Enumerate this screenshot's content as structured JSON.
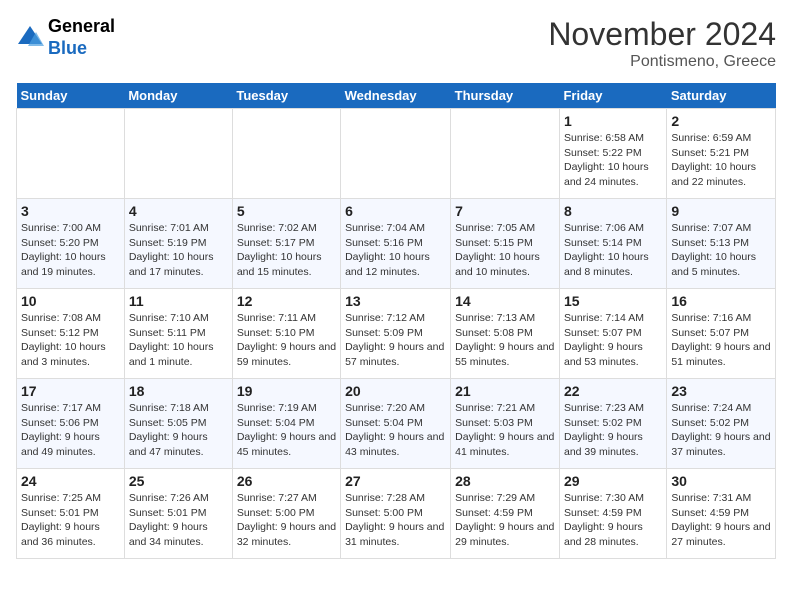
{
  "logo": {
    "line1": "General",
    "line2": "Blue"
  },
  "title": "November 2024",
  "location": "Pontismeno, Greece",
  "days_of_week": [
    "Sunday",
    "Monday",
    "Tuesday",
    "Wednesday",
    "Thursday",
    "Friday",
    "Saturday"
  ],
  "weeks": [
    [
      {
        "day": "",
        "info": ""
      },
      {
        "day": "",
        "info": ""
      },
      {
        "day": "",
        "info": ""
      },
      {
        "day": "",
        "info": ""
      },
      {
        "day": "",
        "info": ""
      },
      {
        "day": "1",
        "info": "Sunrise: 6:58 AM\nSunset: 5:22 PM\nDaylight: 10 hours and 24 minutes."
      },
      {
        "day": "2",
        "info": "Sunrise: 6:59 AM\nSunset: 5:21 PM\nDaylight: 10 hours and 22 minutes."
      }
    ],
    [
      {
        "day": "3",
        "info": "Sunrise: 7:00 AM\nSunset: 5:20 PM\nDaylight: 10 hours and 19 minutes."
      },
      {
        "day": "4",
        "info": "Sunrise: 7:01 AM\nSunset: 5:19 PM\nDaylight: 10 hours and 17 minutes."
      },
      {
        "day": "5",
        "info": "Sunrise: 7:02 AM\nSunset: 5:17 PM\nDaylight: 10 hours and 15 minutes."
      },
      {
        "day": "6",
        "info": "Sunrise: 7:04 AM\nSunset: 5:16 PM\nDaylight: 10 hours and 12 minutes."
      },
      {
        "day": "7",
        "info": "Sunrise: 7:05 AM\nSunset: 5:15 PM\nDaylight: 10 hours and 10 minutes."
      },
      {
        "day": "8",
        "info": "Sunrise: 7:06 AM\nSunset: 5:14 PM\nDaylight: 10 hours and 8 minutes."
      },
      {
        "day": "9",
        "info": "Sunrise: 7:07 AM\nSunset: 5:13 PM\nDaylight: 10 hours and 5 minutes."
      }
    ],
    [
      {
        "day": "10",
        "info": "Sunrise: 7:08 AM\nSunset: 5:12 PM\nDaylight: 10 hours and 3 minutes."
      },
      {
        "day": "11",
        "info": "Sunrise: 7:10 AM\nSunset: 5:11 PM\nDaylight: 10 hours and 1 minute."
      },
      {
        "day": "12",
        "info": "Sunrise: 7:11 AM\nSunset: 5:10 PM\nDaylight: 9 hours and 59 minutes."
      },
      {
        "day": "13",
        "info": "Sunrise: 7:12 AM\nSunset: 5:09 PM\nDaylight: 9 hours and 57 minutes."
      },
      {
        "day": "14",
        "info": "Sunrise: 7:13 AM\nSunset: 5:08 PM\nDaylight: 9 hours and 55 minutes."
      },
      {
        "day": "15",
        "info": "Sunrise: 7:14 AM\nSunset: 5:07 PM\nDaylight: 9 hours and 53 minutes."
      },
      {
        "day": "16",
        "info": "Sunrise: 7:16 AM\nSunset: 5:07 PM\nDaylight: 9 hours and 51 minutes."
      }
    ],
    [
      {
        "day": "17",
        "info": "Sunrise: 7:17 AM\nSunset: 5:06 PM\nDaylight: 9 hours and 49 minutes."
      },
      {
        "day": "18",
        "info": "Sunrise: 7:18 AM\nSunset: 5:05 PM\nDaylight: 9 hours and 47 minutes."
      },
      {
        "day": "19",
        "info": "Sunrise: 7:19 AM\nSunset: 5:04 PM\nDaylight: 9 hours and 45 minutes."
      },
      {
        "day": "20",
        "info": "Sunrise: 7:20 AM\nSunset: 5:04 PM\nDaylight: 9 hours and 43 minutes."
      },
      {
        "day": "21",
        "info": "Sunrise: 7:21 AM\nSunset: 5:03 PM\nDaylight: 9 hours and 41 minutes."
      },
      {
        "day": "22",
        "info": "Sunrise: 7:23 AM\nSunset: 5:02 PM\nDaylight: 9 hours and 39 minutes."
      },
      {
        "day": "23",
        "info": "Sunrise: 7:24 AM\nSunset: 5:02 PM\nDaylight: 9 hours and 37 minutes."
      }
    ],
    [
      {
        "day": "24",
        "info": "Sunrise: 7:25 AM\nSunset: 5:01 PM\nDaylight: 9 hours and 36 minutes."
      },
      {
        "day": "25",
        "info": "Sunrise: 7:26 AM\nSunset: 5:01 PM\nDaylight: 9 hours and 34 minutes."
      },
      {
        "day": "26",
        "info": "Sunrise: 7:27 AM\nSunset: 5:00 PM\nDaylight: 9 hours and 32 minutes."
      },
      {
        "day": "27",
        "info": "Sunrise: 7:28 AM\nSunset: 5:00 PM\nDaylight: 9 hours and 31 minutes."
      },
      {
        "day": "28",
        "info": "Sunrise: 7:29 AM\nSunset: 4:59 PM\nDaylight: 9 hours and 29 minutes."
      },
      {
        "day": "29",
        "info": "Sunrise: 7:30 AM\nSunset: 4:59 PM\nDaylight: 9 hours and 28 minutes."
      },
      {
        "day": "30",
        "info": "Sunrise: 7:31 AM\nSunset: 4:59 PM\nDaylight: 9 hours and 27 minutes."
      }
    ]
  ]
}
